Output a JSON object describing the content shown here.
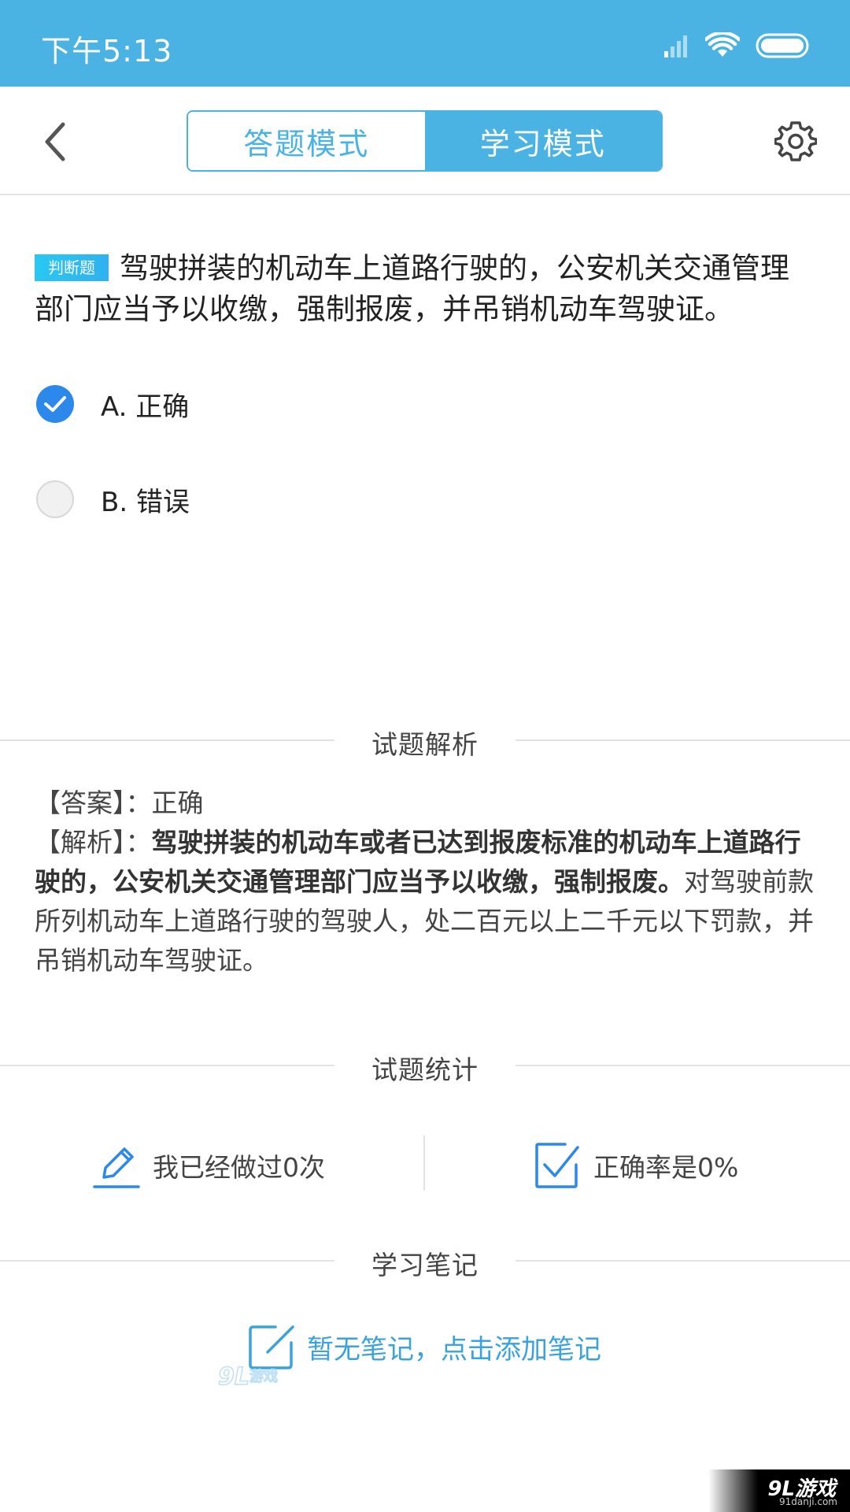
{
  "status_bar": {
    "time": "下午5:13",
    "icons": [
      "signal-icon",
      "wifi-icon",
      "battery-icon"
    ]
  },
  "nav": {
    "back_icon": "chevron-left-icon",
    "tabs": [
      {
        "label": "答题模式",
        "active": false
      },
      {
        "label": "学习模式",
        "active": true
      }
    ],
    "settings_icon": "gear-icon",
    "accent_color": "#4ab3e3"
  },
  "question": {
    "type_badge": "判断题",
    "text": "驾驶拼装的机动车上道路行驶的，公安机关交通管理部门应当予以收缴，强制报废，并吊销机动车驾驶证。",
    "options": [
      {
        "label": "A. 正确",
        "selected": true
      },
      {
        "label": "B. 错误",
        "selected": false
      }
    ]
  },
  "analysis_section": {
    "title": "试题解析",
    "answer_label": "【答案】：",
    "answer_value": "正确",
    "explain_label": "【解析】：",
    "explain_bold": "驾驶拼装的机动车或者已达到报废标准的机动车上道路行驶的，公安机关交通管理部门应当予以收缴，强制报废。",
    "explain_rest": "对驾驶前款所列机动车上道路行驶的驾驶人，处二百元以上二千元以下罚款，并吊销机动车驾驶证。"
  },
  "stats_section": {
    "title": "试题统计",
    "done_count_text": "我已经做过0次",
    "accuracy_text": "正确率是0%"
  },
  "notes_section": {
    "title": "学习笔记",
    "empty_action": "暂无笔记，点击添加笔记"
  },
  "watermark": {
    "main": "9L游戏",
    "sub": "91danji.com"
  }
}
